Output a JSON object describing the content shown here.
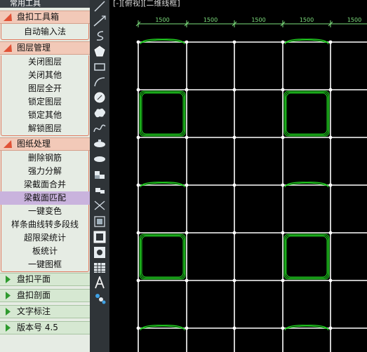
{
  "panel": {
    "title": "常用工具",
    "groups": [
      {
        "label": "盘扣工具箱",
        "expanded": true,
        "items": [
          "自动输入法"
        ]
      },
      {
        "label": "图层管理",
        "expanded": true,
        "items": [
          "关闭图层",
          "关闭其他",
          "图层全开",
          "锁定图层",
          "锁定其他",
          "解锁图层"
        ]
      },
      {
        "label": "图纸处理",
        "expanded": true,
        "items": [
          "删除钢筋",
          "强力分解",
          "梁截面合并",
          "梁截面匹配",
          "一键变色",
          "样条曲线转多段线",
          "超限梁统计",
          "板统计",
          "一键图框"
        ]
      },
      {
        "label": "盘扣平面",
        "expanded": false
      },
      {
        "label": "盘扣剖面",
        "expanded": false
      },
      {
        "label": "文字标注",
        "expanded": false
      },
      {
        "label": "版本号 4.5",
        "expanded": false
      }
    ],
    "selected_item": "梁截面匹配"
  },
  "toolbar": {
    "tools": [
      "line-tool-icon",
      "construction-line-icon",
      "polyline-icon",
      "polygon-icon",
      "rectangle-icon",
      "arc-icon",
      "circle-icon",
      "revision-cloud-icon",
      "spline-icon",
      "ellipse-icon",
      "insert-block-icon",
      "make-block-icon",
      "point-icon",
      "hatch-icon",
      "region-icon",
      "table-icon",
      "text-icon",
      "add-selected-icon"
    ]
  },
  "viewport": {
    "label": "[-][俯视][二维线框]",
    "dimensions": [
      "1500",
      "1500",
      "1500",
      "1500",
      "1500"
    ],
    "colors": {
      "grid": "#ffffff",
      "highlight": "#22dd22",
      "dimension": "#7ee07e",
      "node": "#ffffff"
    }
  }
}
